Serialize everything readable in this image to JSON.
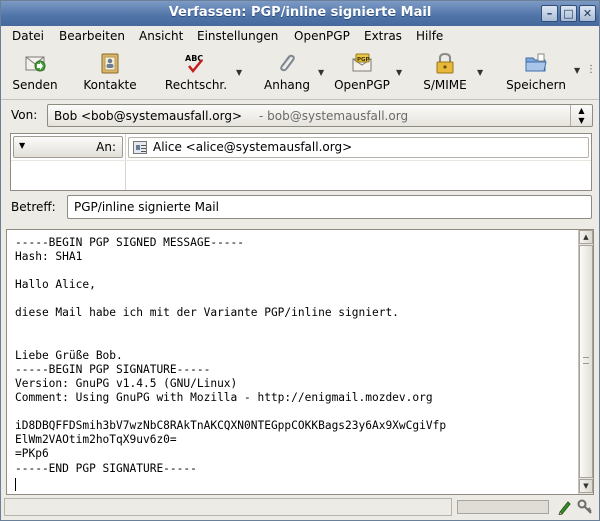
{
  "window": {
    "title": "Verfassen: PGP/inline signierte Mail"
  },
  "titlebar_buttons": [
    "minimize",
    "maximize",
    "close"
  ],
  "menu": [
    {
      "label": "Datei"
    },
    {
      "label": "Bearbeiten"
    },
    {
      "label": "Ansicht"
    },
    {
      "label": "Einstellungen"
    },
    {
      "label": "OpenPGP"
    },
    {
      "label": "Extras"
    },
    {
      "label": "Hilfe"
    }
  ],
  "toolbar": {
    "send": "Senden",
    "contacts": "Kontakte",
    "spelling": "Rechtschr.",
    "attach": "Anhang",
    "openpgp": "OpenPGP",
    "smime": "S/MIME",
    "save": "Speichern"
  },
  "from": {
    "label": "Von:",
    "value": "Bob <bob@systemausfall.org>",
    "secondary": "- bob@systemausfall.org"
  },
  "recipient": {
    "type": "An:",
    "value": "Alice <alice@systemausfall.org>"
  },
  "subject": {
    "label": "Betreff:",
    "value": "PGP/inline signierte Mail"
  },
  "body": {
    "lines": [
      "-----BEGIN PGP SIGNED MESSAGE-----",
      "Hash: SHA1",
      "",
      "Hallo Alice,",
      "",
      "diese Mail habe ich mit der Variante PGP/inline signiert.",
      "",
      "",
      "Liebe Grüße Bob.",
      "-----BEGIN PGP SIGNATURE-----",
      "Version: GnuPG v1.4.5 (GNU/Linux)",
      "Comment: Using GnuPG with Mozilla - http://enigmail.mozdev.org",
      "",
      "iD8DBQFFDSmih3bV7wzNbC8RAkTnAKCQXN0NTEGppCOKKBags23y6Ax9XwCgiVfp",
      "ElWm2VAOtim2hoTqX9uv6z0=",
      "=PKp6",
      "-----END PGP SIGNATURE-----"
    ]
  },
  "colors": {
    "titlebar": "#4f74a8",
    "window_bg": "#edebe6",
    "text_field_bg": "#ffffff"
  }
}
